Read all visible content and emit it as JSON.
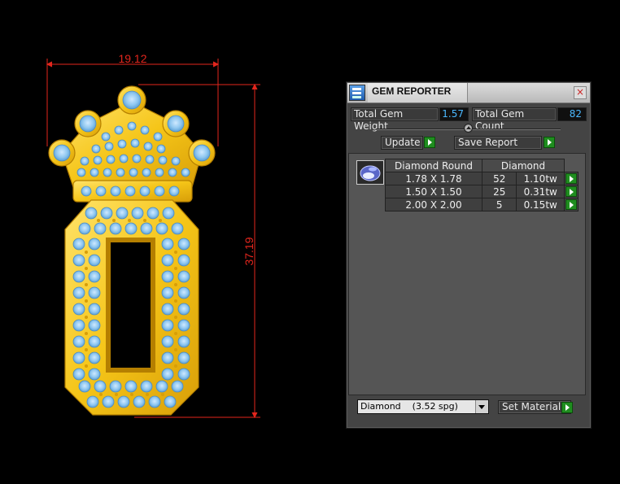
{
  "drawing": {
    "width_dimension": "19.12",
    "height_dimension": "37.19"
  },
  "panel": {
    "title": "GEM REPORTER",
    "close_label": "×",
    "total_weight_label": "Total Gem Weight",
    "total_weight_value": "1.57",
    "total_count_label": "Total Gem Count",
    "total_count_value": "82",
    "update_label": "Update",
    "save_report_label": "Save Report",
    "table": {
      "headers": [
        "Diamond Round",
        "Diamond"
      ],
      "rows": [
        {
          "size": "1.78 X 1.78",
          "count": "52",
          "weight": "1.10tw"
        },
        {
          "size": "1.50 X 1.50",
          "count": "25",
          "weight": "0.31tw"
        },
        {
          "size": "2.00 X 2.00",
          "count": "5",
          "weight": "0.15tw"
        }
      ]
    },
    "material_select": "Diamond    (3.52 spg)",
    "set_material_label": "Set Material"
  },
  "colors": {
    "gold": "#f5c518",
    "stone": "#8fc7f0",
    "dimension": "#e3261d",
    "value_text": "#4ab8ff",
    "go_button": "#1f8d1f"
  }
}
